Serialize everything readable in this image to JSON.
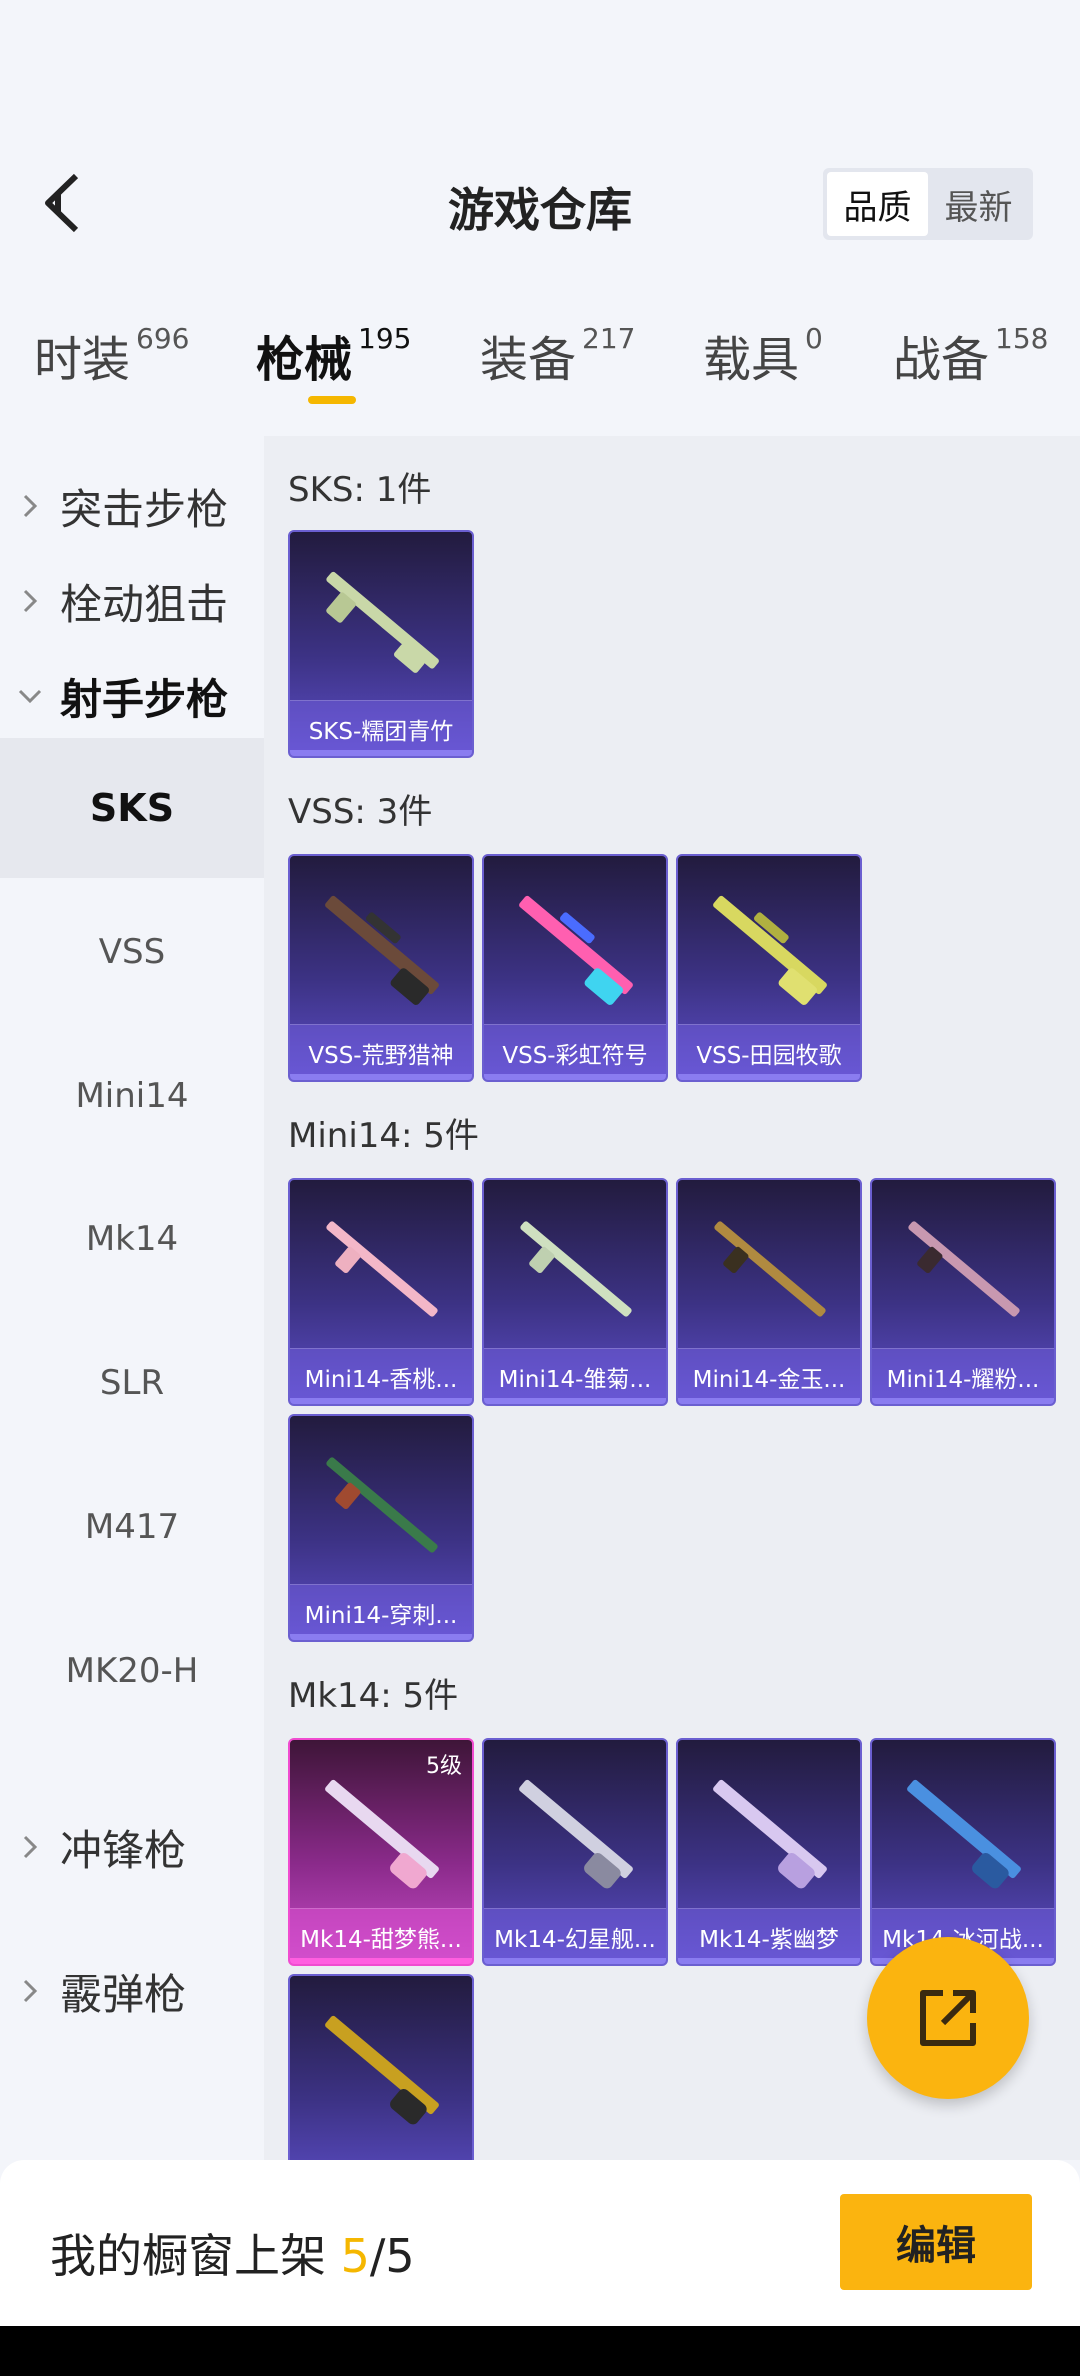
{
  "header": {
    "title": "游戏仓库",
    "sort": [
      "品质",
      "最新"
    ]
  },
  "tabs": [
    {
      "label": "时装",
      "count": "696"
    },
    {
      "label": "枪械",
      "count": "195"
    },
    {
      "label": "装备",
      "count": "217"
    },
    {
      "label": "载具",
      "count": "0"
    },
    {
      "label": "战备",
      "count": "158"
    }
  ],
  "sidebar": {
    "groups": [
      "突击步枪",
      "栓动狙击",
      "射手步枪",
      "冲锋枪",
      "霰弹枪"
    ],
    "items": [
      "SKS",
      "VSS",
      "Mini14",
      "Mk14",
      "SLR",
      "M417",
      "MK20-H"
    ]
  },
  "sections": [
    {
      "title": "SKS: 1件",
      "items": [
        "SKS-糯团青竹"
      ]
    },
    {
      "title": "VSS: 3件",
      "items": [
        "VSS-荒野猎神",
        "VSS-彩虹符号",
        "VSS-田园牧歌"
      ]
    },
    {
      "title": "Mini14: 5件",
      "items": [
        "Mini14-香桃...",
        "Mini14-雏菊...",
        "Mini14-金玉...",
        "Mini14-耀粉...",
        "Mini14-穿刺..."
      ]
    },
    {
      "title": "Mk14: 5件",
      "items": [
        "Mk14-甜梦熊...",
        "Mk14-幻星舰...",
        "Mk14-紫幽梦",
        "Mk14-冰河战..."
      ],
      "level": "5级"
    }
  ],
  "bottom": {
    "prefix": "我的橱窗上架 ",
    "current": "5",
    "sep": "/",
    "total": "5",
    "edit": "编辑"
  },
  "colors": {
    "accent": "#fbb40f",
    "card_border": "#6b5fd0",
    "card_pink": "#f04cd0"
  }
}
